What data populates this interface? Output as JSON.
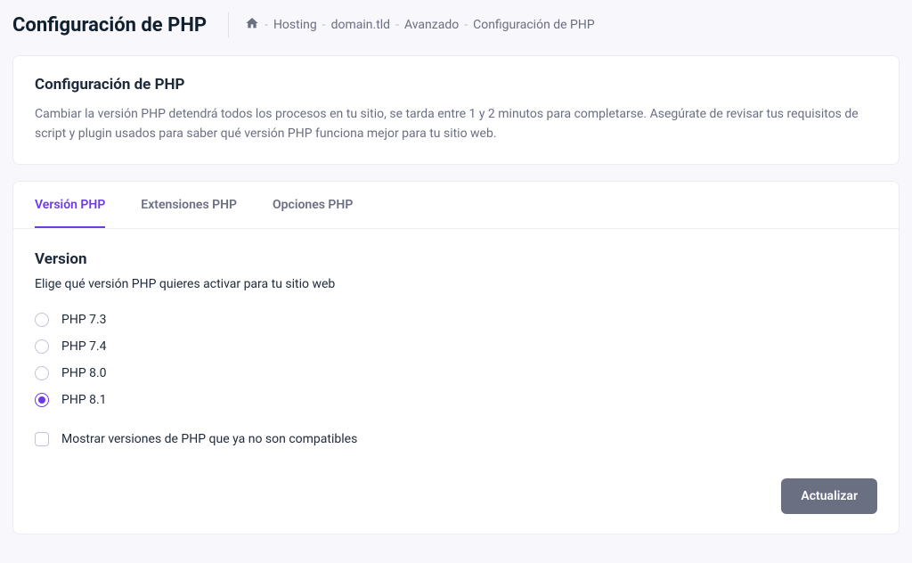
{
  "header": {
    "title": "Configuración de PHP",
    "breadcrumb": {
      "home_icon": "home-icon",
      "items": [
        "Hosting",
        "domain.tld",
        "Avanzado",
        "Configuración de PHP"
      ],
      "separator": "-"
    }
  },
  "intro": {
    "title": "Configuración de PHP",
    "description": "Cambiar la versión PHP detendrá todos los procesos en tu sitio, se tarda entre 1 y 2 minutos para completarse. Asegúrate de revisar tus requisitos de script y plugin usados para saber qué versión PHP funciona mejor para tu sitio web."
  },
  "tabs": {
    "items": [
      {
        "label": "Versión PHP",
        "active": true
      },
      {
        "label": "Extensiones PHP",
        "active": false
      },
      {
        "label": "Opciones PHP",
        "active": false
      }
    ]
  },
  "version": {
    "title": "Version",
    "description": "Elige qué versión PHP quieres activar para tu sitio web",
    "options": [
      {
        "label": "PHP 7.3",
        "selected": false
      },
      {
        "label": "PHP 7.4",
        "selected": false
      },
      {
        "label": "PHP 8.0",
        "selected": false
      },
      {
        "label": "PHP 8.1",
        "selected": true
      }
    ],
    "show_unsupported_label": "Mostrar versiones de PHP que ya no son compatibles",
    "show_unsupported_checked": false
  },
  "actions": {
    "update_label": "Actualizar"
  },
  "colors": {
    "accent": "#6d3be4",
    "text_muted": "#6b6f82",
    "button_bg": "#6b6f82"
  }
}
